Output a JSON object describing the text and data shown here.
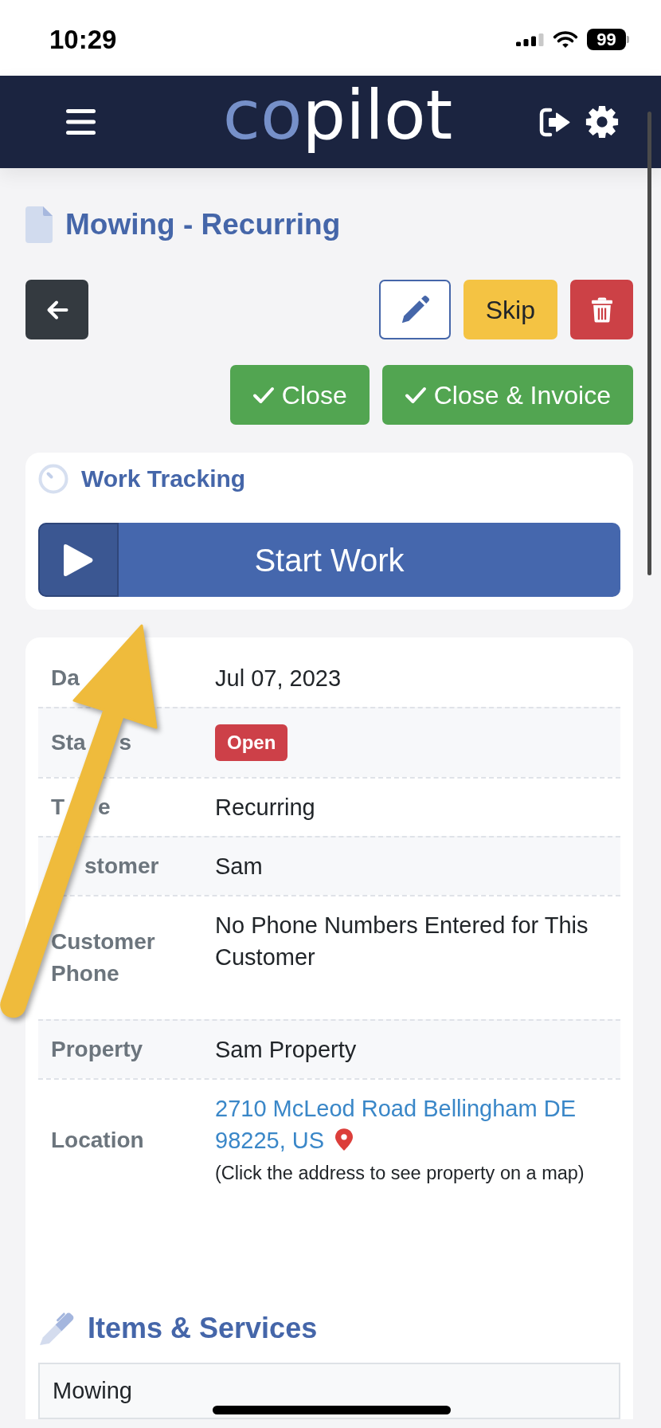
{
  "status_bar": {
    "time": "10:29",
    "battery": "99"
  },
  "navbar": {
    "logo": {
      "accent": "co",
      "rest": "pilot"
    }
  },
  "title": "Mowing - Recurring",
  "actions": [
    {
      "kind": "back"
    },
    {
      "kind": "edit"
    },
    {
      "kind": "skip",
      "label": "Skip"
    },
    {
      "kind": "delete"
    }
  ],
  "close_actions": [
    {
      "label": "Close"
    },
    {
      "label": "Close & Invoice"
    }
  ],
  "work_tracking": {
    "title": "Work Tracking",
    "button": "Start Work"
  },
  "details": [
    {
      "label_left": "Da",
      "kind": "text",
      "value": "Jul 07, 2023"
    },
    {
      "label_left": "Sta",
      "label_right": "s",
      "kind": "badge",
      "value": "Open"
    },
    {
      "label_left": "T",
      "label_right": "e",
      "kind": "text",
      "value": "Recurring"
    },
    {
      "label_right": "stomer",
      "kind": "text",
      "value": "Sam"
    },
    {
      "label": "Customer Phone",
      "kind": "phone",
      "value": "No Phone Numbers Entered for This Customer"
    },
    {
      "label": "Property",
      "kind": "text",
      "value": "Sam Property"
    },
    {
      "label": "Location",
      "kind": "address",
      "value": "2710 McLeod Road Bellingham DE 98225, US",
      "note": "(Click the address to see property on a map)"
    }
  ],
  "items": {
    "title": "Items & Services",
    "rows": [
      {
        "name": "Mowing"
      }
    ]
  }
}
